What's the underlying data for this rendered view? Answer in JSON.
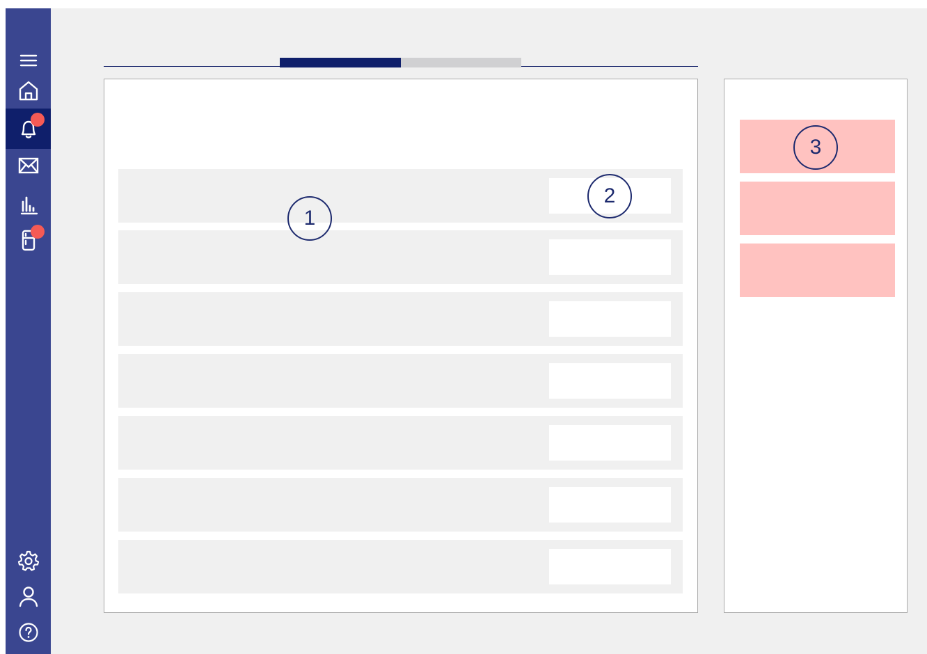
{
  "theme": {
    "sidebar_bg": "#3a4690",
    "sidebar_active_bg": "#0f1f6b",
    "canvas_bg": "#f0f0f0",
    "badge_color": "#f55a55",
    "tab_active_color": "#0f1f6b",
    "tab_inactive_color": "#d0d0d2",
    "alert_card_color": "#ffc2c0",
    "callout_color": "#1d2a6e"
  },
  "sidebar": {
    "top_items": [
      {
        "icon": "menu-icon",
        "active": false,
        "badge": false
      },
      {
        "icon": "home-icon",
        "active": false,
        "badge": false
      },
      {
        "icon": "bell-icon",
        "active": true,
        "badge": true
      },
      {
        "icon": "mail-icon",
        "active": false,
        "badge": false
      },
      {
        "icon": "bar-chart-icon",
        "active": false,
        "badge": false
      },
      {
        "icon": "fridge-icon",
        "active": false,
        "badge": true
      }
    ],
    "bottom_items": [
      {
        "icon": "gear-icon"
      },
      {
        "icon": "user-icon"
      },
      {
        "icon": "help-icon"
      }
    ]
  },
  "tabs": [
    {
      "state": "active"
    },
    {
      "state": "inactive"
    }
  ],
  "main": {
    "row_count": 7
  },
  "side": {
    "alert_card_count": 3
  },
  "callouts": {
    "list": "1",
    "action": "2",
    "alerts": "3"
  }
}
